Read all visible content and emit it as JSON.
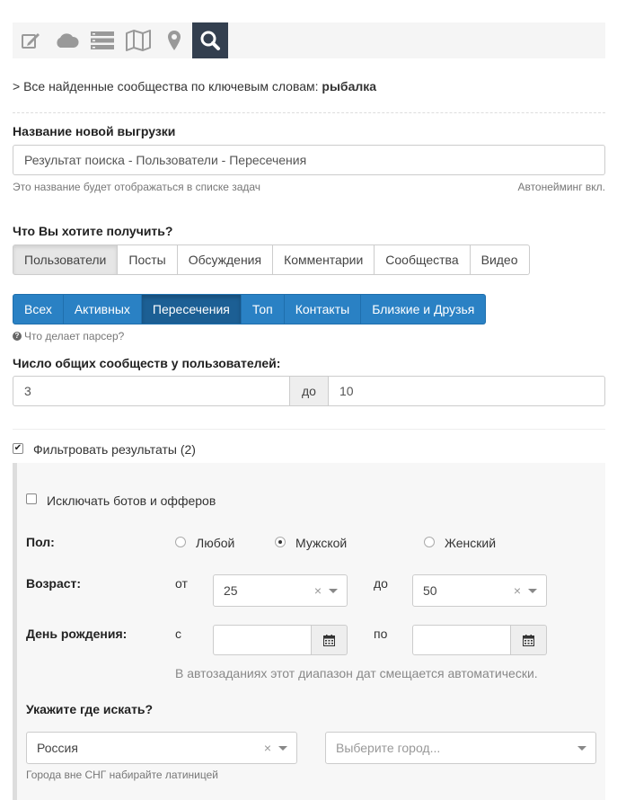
{
  "toolbar": {
    "icons": [
      "edit-icon",
      "cloud-icon",
      "list-icon",
      "map-icon",
      "location-pin-icon",
      "search-icon"
    ],
    "active": "search-icon"
  },
  "breadcrumb": {
    "prefix": "> Все найденные сообщества по ключевым словам:",
    "keyword": "рыбалка"
  },
  "export_name": {
    "label": "Название новой выгрузки",
    "value": "Результат поиска - Пользователи - Пересечения",
    "help": "Это название будет отображаться в списке задач",
    "autonaming": "Автонейминг вкл."
  },
  "what_to_get": {
    "label": "Что Вы хотите получить?",
    "tabs": [
      "Пользователи",
      "Посты",
      "Обсуждения",
      "Комментарии",
      "Сообщества",
      "Видео"
    ],
    "active_tab": "Пользователи"
  },
  "parser_modes": {
    "tabs": [
      "Всех",
      "Активных",
      "Пересечения",
      "Топ",
      "Контакты",
      "Близкие и Друзья"
    ],
    "active_tab": "Пересечения",
    "help_link": "Что делает парсер?"
  },
  "common_groups": {
    "label": "Число общих сообществ у пользователей:",
    "from": "3",
    "to_label": "до",
    "to": "10"
  },
  "filter": {
    "label": "Фильтровать результаты (2)",
    "checked": true,
    "exclude_bots": {
      "label": "Исключать ботов и офферов",
      "checked": false
    },
    "gender": {
      "label": "Пол:",
      "options": [
        "Любой",
        "Мужской",
        "Женский"
      ],
      "selected": "Мужской"
    },
    "age": {
      "label": "Возраст:",
      "from_label": "от",
      "from": "25",
      "to_label": "до",
      "to": "50"
    },
    "birthday": {
      "label": "День рождения:",
      "from_label": "с",
      "to_label": "по",
      "note": "В автозаданиях этот диапазон дат смещается автоматически."
    },
    "location": {
      "label": "Укажите где искать?",
      "country": "Россия",
      "city_placeholder": "Выберите город...",
      "help": "Города вне СНГ набирайте латиницей"
    }
  },
  "colors": {
    "toolbar_active": "#333f4f",
    "primary_blue": "#2a81c4",
    "primary_blue_active": "#1c5f94"
  }
}
